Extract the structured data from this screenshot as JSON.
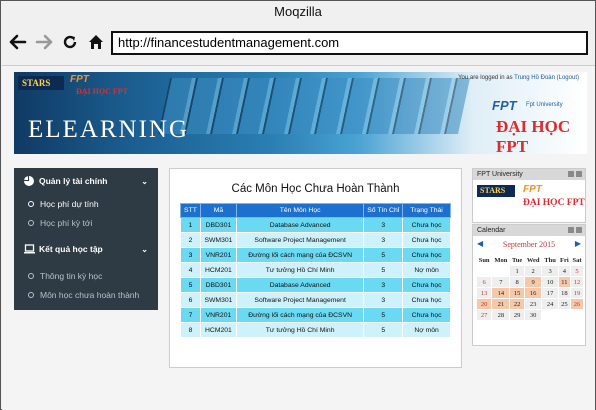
{
  "browser": {
    "title": "Moqzilla",
    "url": "http://financestudentmanagement.com"
  },
  "banner": {
    "elearning": "ELEARNING",
    "stars_logo": "STARS",
    "fpt_logo": "FPT",
    "dai_hoc_fpt_small": "ĐẠI HỌC FPT",
    "logged_in_text": "You are logged in as",
    "logged_in_user": "Trung Hồ Đoàn (Logout)",
    "fpt_big": "FPT",
    "fpt_university": "Fpt University",
    "dai_hoc_fpt_big": "ĐẠI HỌC FPT"
  },
  "sidebar": {
    "section1": {
      "label": "Quản lý tài chính"
    },
    "section1_items": [
      {
        "label": "Học phí dự tính",
        "active": true
      },
      {
        "label": "Học phí kỳ tới",
        "active": false
      }
    ],
    "section2": {
      "label": "Kết quả học tập"
    },
    "section2_items": [
      {
        "label": "Thông tin kỳ học",
        "active": false
      },
      {
        "label": "Môn học chưa hoàn thành",
        "active": false
      }
    ]
  },
  "main": {
    "title": "Các Môn Học Chưa Hoàn Thành",
    "columns": [
      "STT",
      "Mã",
      "Tên Môn Học",
      "Số Tín Chỉ",
      "Trạng Thái"
    ],
    "rows": [
      [
        "1",
        "DBD301",
        "Database Advanced",
        "3",
        "Chưa học"
      ],
      [
        "2",
        "SWM301",
        "Software Project Management",
        "3",
        "Chưa học"
      ],
      [
        "3",
        "VNR201",
        "Đường lối cách mạng của ĐCSVN",
        "5",
        "Chưa học"
      ],
      [
        "4",
        "HCM201",
        "Tư tưởng Hồ Chí Minh",
        "5",
        "Nợ môn"
      ],
      [
        "5",
        "DBD301",
        "Database Advanced",
        "3",
        "Chưa học"
      ],
      [
        "6",
        "SWM301",
        "Software Project Management",
        "3",
        "Chưa học"
      ],
      [
        "7",
        "VNR201",
        "Đường lối cách mạng của ĐCSVN",
        "5",
        "Chưa học"
      ],
      [
        "8",
        "HCM201",
        "Tư tưởng Hồ Chí Minh",
        "5",
        "Nợ môn"
      ]
    ]
  },
  "right": {
    "fpt_box_title": "FPT University",
    "stars_logo": "STARS",
    "fpt_logo": "FPT",
    "dai_hoc_fpt": "ĐẠI HỌC FPT",
    "calendar_title": "Calendar",
    "calendar_month": "September 2015",
    "prev_arrow": "◀",
    "next_arrow": "▶",
    "weekdays": [
      "Sun",
      "Mon",
      "Tue",
      "Wed",
      "Thu",
      "Fri",
      "Sat"
    ],
    "weeks": [
      [
        "",
        "",
        "1",
        "2",
        "3",
        "4",
        "5"
      ],
      [
        "6",
        "7",
        "8",
        "9",
        "10",
        "11",
        "12"
      ],
      [
        "13",
        "14",
        "15",
        "16",
        "17",
        "18",
        "19"
      ],
      [
        "20",
        "21",
        "22",
        "23",
        "24",
        "25",
        "26"
      ],
      [
        "27",
        "28",
        "29",
        "30",
        "",
        "",
        ""
      ]
    ],
    "event_days": [
      "9",
      "11",
      "14",
      "15",
      "16",
      "20",
      "21",
      "22",
      "26"
    ]
  },
  "colors": {
    "accent": "#1e70cf",
    "row_odd": "#6ad9f2",
    "row_even": "#cdf2fb",
    "sidebar_bg": "#2e3a44"
  }
}
